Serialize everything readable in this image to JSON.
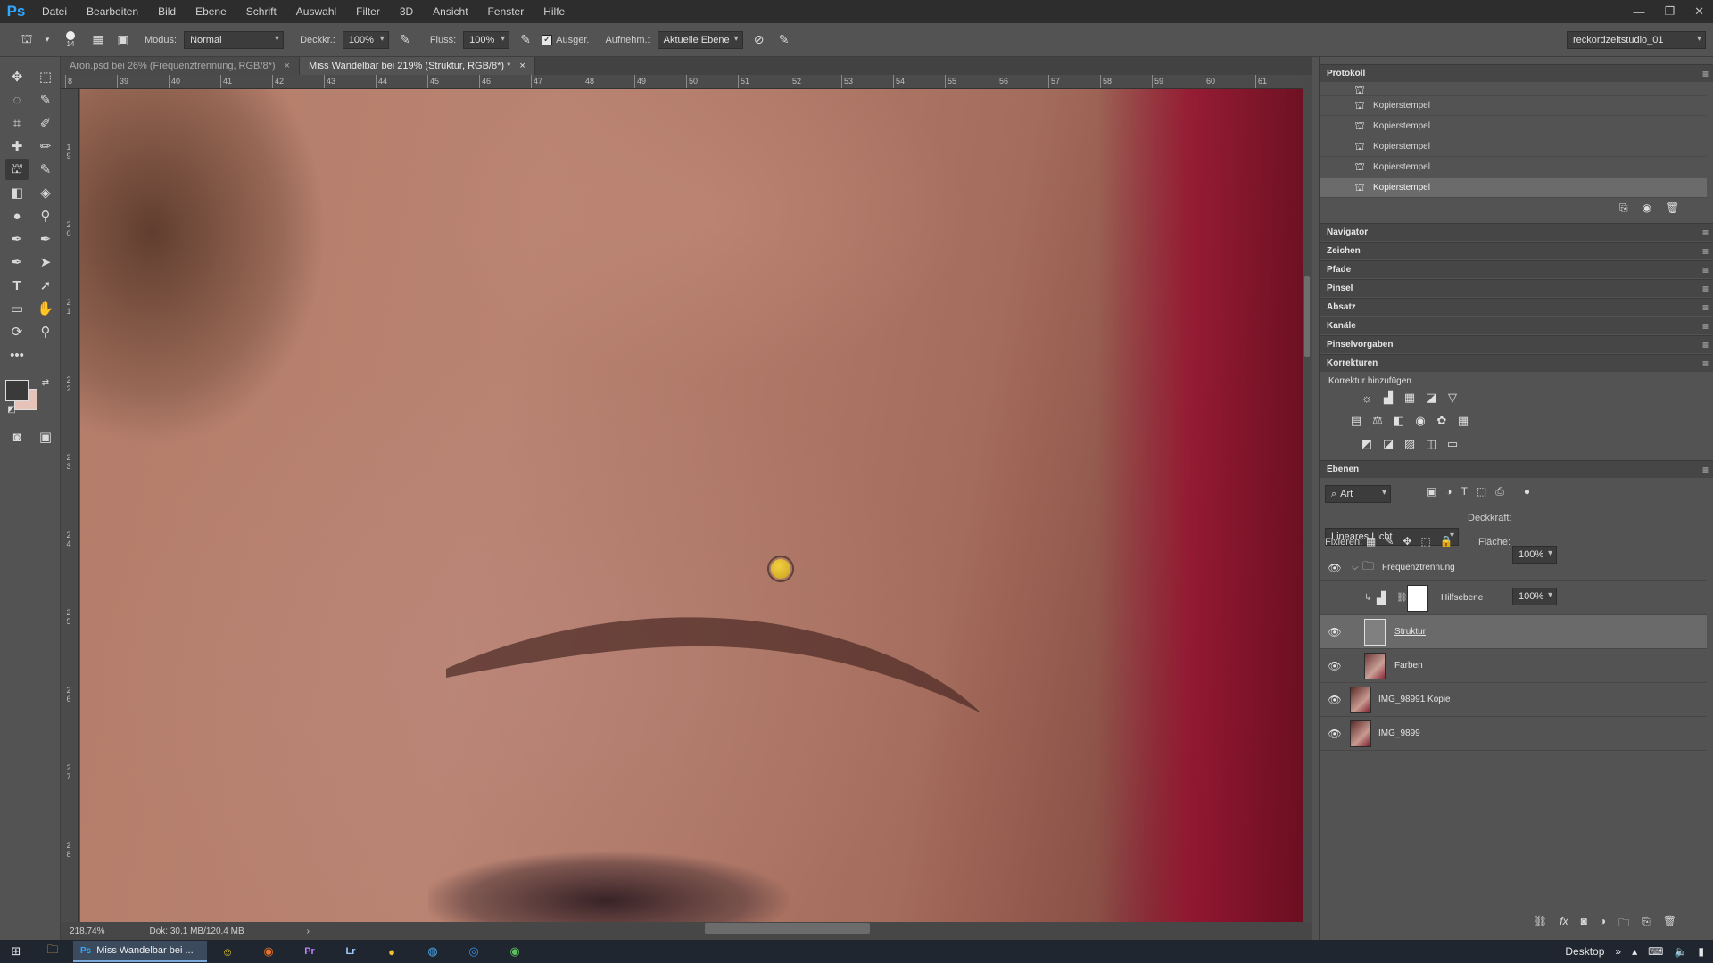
{
  "menubar": {
    "logo": "Ps",
    "items": [
      "Datei",
      "Bearbeiten",
      "Bild",
      "Ebene",
      "Schrift",
      "Auswahl",
      "Filter",
      "3D",
      "Ansicht",
      "Fenster",
      "Hilfe"
    ],
    "window_controls": [
      "—",
      "❐",
      "✕"
    ]
  },
  "options": {
    "brush_size": "14",
    "modus_label": "Modus:",
    "modus_value": "Normal",
    "deckkraft_label": "Deckkr.:",
    "deckkraft_value": "100%",
    "fluss_label": "Fluss:",
    "fluss_value": "100%",
    "ausgerichtet_label": "Ausger.",
    "aufnehmen_label": "Aufnehm.:",
    "aufnehmen_value": "Aktuelle Ebene",
    "workspace": "reckordzeitstudio_01"
  },
  "tabs": [
    {
      "label": "Aron.psd bei 26% (Frequenztrennung, RGB/8*)",
      "close": "×"
    },
    {
      "label": "Miss Wandelbar bei 219% (Struktur, RGB/8*) *",
      "close": "×"
    }
  ],
  "ruler_top": [
    "8",
    "39",
    "40",
    "41",
    "42",
    "43",
    "44",
    "45",
    "46",
    "47",
    "48",
    "49",
    "50",
    "51",
    "52",
    "53",
    "54",
    "55",
    "56",
    "57",
    "58",
    "59",
    "60",
    "61"
  ],
  "ruler_left": [
    "1 9",
    "2 0",
    "2 1",
    "2 2",
    "2 3",
    "2 4",
    "2 5",
    "2 6",
    "2 7",
    "2 8"
  ],
  "status": {
    "zoom": "218,74%",
    "doc": "Dok: 30,1 MB/120,4 MB"
  },
  "protokoll": {
    "title": "Protokoll",
    "rows": [
      "Kopierstempel",
      "Kopierstempel",
      "Kopierstempel",
      "Kopierstempel",
      "Kopierstempel",
      "Kopierstempel"
    ]
  },
  "collapsed_panels": [
    "Navigator",
    "Zeichen",
    "Pfade",
    "Pinsel",
    "Absatz",
    "Kanäle",
    "Pinselvorgaben",
    "Korrekturen"
  ],
  "korrekturen": {
    "add_label": "Korrektur hinzufügen"
  },
  "ebenen": {
    "title": "Ebenen",
    "filter": "Art",
    "blend_mode": "Lineares Licht",
    "deckkraft_label": "Deckkraft:",
    "deckkraft_value": "100%",
    "fixieren_label": "Fixieren:",
    "flaeche_label": "Fläche:",
    "flaeche_value": "100%",
    "layers": [
      {
        "name": "Frequenztrennung"
      },
      {
        "name": "Hilfsebene"
      },
      {
        "name": "Struktur"
      },
      {
        "name": "Farben"
      },
      {
        "name": "IMG_98991 Kopie"
      },
      {
        "name": "IMG_9899"
      }
    ]
  },
  "taskbar": {
    "task_label": "Miss Wandelbar bei ...",
    "desktop_label": "Desktop"
  },
  "colors": {
    "accent": "#31a8ff",
    "foreground_swatch": "#3a3a3a",
    "background_swatch": "#e6c2b8",
    "brush_cursor": "#e0bd30"
  }
}
